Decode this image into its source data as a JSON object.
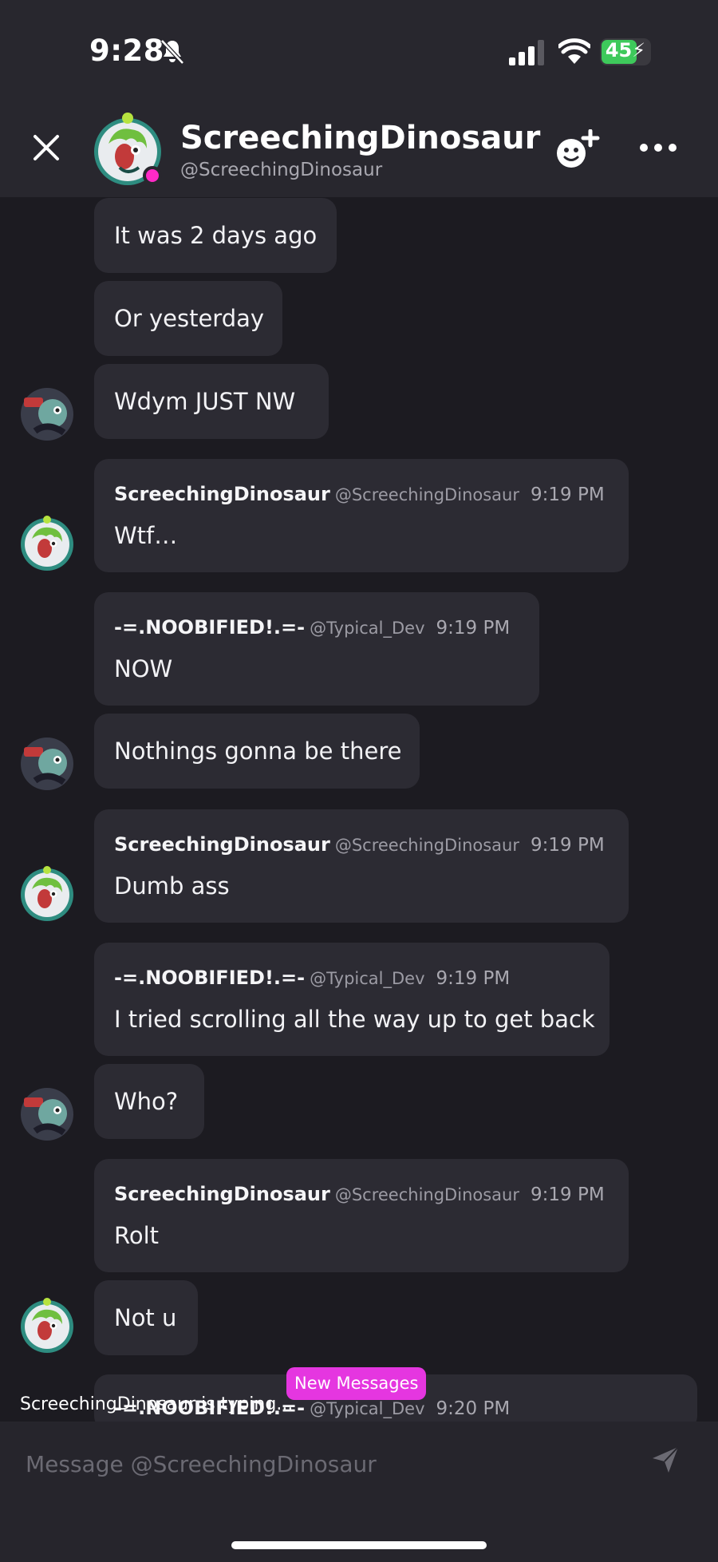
{
  "status_bar": {
    "time": "9:28",
    "battery": "45",
    "icons": [
      "bell-slash-icon",
      "cellular-signal-icon",
      "wifi-icon",
      "battery-charging-icon"
    ]
  },
  "header": {
    "name": "ScreechingDinosaur",
    "handle": "@ScreechingDinosaur",
    "presence_color": "#ff2ac6",
    "icons": [
      "close-icon",
      "add-friend-icon",
      "more-icon"
    ]
  },
  "messages": [
    {
      "author": "",
      "handle": "",
      "time": "",
      "text": "It was 2 days ago"
    },
    {
      "author": "",
      "handle": "",
      "time": "",
      "text": "Or yesterday"
    },
    {
      "author": "",
      "handle": "",
      "time": "",
      "text": "Wdym JUST NW"
    },
    {
      "author": "ScreechingDinosaur",
      "handle": "@ScreechingDinosaur",
      "time": "9:19 PM",
      "text": "Wtf…"
    },
    {
      "author": "-=.NOOBIFIED!.=-",
      "handle": "@Typical_Dev",
      "time": "9:19 PM",
      "text": "NOW"
    },
    {
      "author": "",
      "handle": "",
      "time": "",
      "text": "Nothings gonna be there"
    },
    {
      "author": "ScreechingDinosaur",
      "handle": "@ScreechingDinosaur",
      "time": "9:19 PM",
      "text": "Dumb ass"
    },
    {
      "author": "-=.NOOBIFIED!.=-",
      "handle": "@Typical_Dev",
      "time": "9:19 PM",
      "text": "I tried scrolling all the way up to get back"
    },
    {
      "author": "",
      "handle": "",
      "time": "",
      "text": "Who?"
    },
    {
      "author": "ScreechingDinosaur",
      "handle": "@ScreechingDinosaur",
      "time": "9:19 PM",
      "text": "Rolt"
    },
    {
      "author": "",
      "handle": "",
      "time": "",
      "text": "Not u"
    },
    {
      "author": "-=.NOOBIFIED!.=-",
      "handle": "@Typical_Dev",
      "time": "9:20 PM",
      "text": ""
    }
  ],
  "typing_indicator": "ScreechingDinosaur is typing...",
  "new_messages_label": "New Messages",
  "composer": {
    "placeholder": "Message @ScreechingDinosaur",
    "value": ""
  },
  "colors": {
    "background": "#1c1b21",
    "header_bg": "#28272e",
    "bubble_bg": "#2c2b33",
    "accent_pink": "#e536e0"
  }
}
